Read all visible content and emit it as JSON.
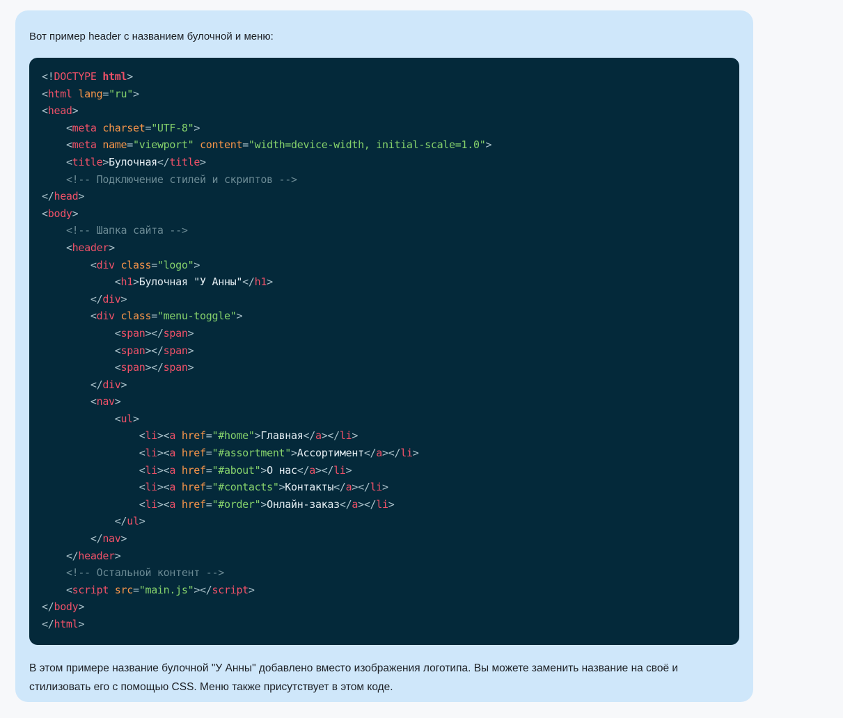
{
  "message": {
    "intro": "Вот пример header с названием булочной и меню:",
    "outro": "В этом примере название булочной \"У Анны\" добавлено вместо изображения логотипа. Вы можете заменить название на своё и стилизовать его с помощью CSS. Меню также присутствует в этом коде."
  },
  "colors": {
    "page_bg": "#f7f8fa",
    "bubble_bg": "#cfe7fa",
    "code_bg": "#04293a",
    "punct": "#a9c0c9",
    "tag": "#ef5168",
    "attr": "#f8964a",
    "string": "#85d16b",
    "comment": "#6b8a94",
    "plain": "#e3edf2",
    "body_text": "#1d2025"
  },
  "code": {
    "language": "html",
    "lines": [
      [
        [
          "p",
          "<!"
        ],
        [
          "t",
          "DOCTYPE "
        ],
        [
          "b",
          "html"
        ],
        [
          "p",
          ">"
        ]
      ],
      [
        [
          "p",
          "<"
        ],
        [
          "t",
          "html"
        ],
        [
          "w",
          " "
        ],
        [
          "a",
          "lang"
        ],
        [
          "p",
          "="
        ],
        [
          "s",
          "\"ru\""
        ],
        [
          "p",
          ">"
        ]
      ],
      [
        [
          "p",
          "<"
        ],
        [
          "t",
          "head"
        ],
        [
          "p",
          ">"
        ]
      ],
      [
        [
          "w",
          "    "
        ],
        [
          "p",
          "<"
        ],
        [
          "t",
          "meta"
        ],
        [
          "w",
          " "
        ],
        [
          "a",
          "charset"
        ],
        [
          "p",
          "="
        ],
        [
          "s",
          "\"UTF-8\""
        ],
        [
          "p",
          ">"
        ]
      ],
      [
        [
          "w",
          "    "
        ],
        [
          "p",
          "<"
        ],
        [
          "t",
          "meta"
        ],
        [
          "w",
          " "
        ],
        [
          "a",
          "name"
        ],
        [
          "p",
          "="
        ],
        [
          "s",
          "\"viewport\""
        ],
        [
          "w",
          " "
        ],
        [
          "a",
          "content"
        ],
        [
          "p",
          "="
        ],
        [
          "s",
          "\"width=device-width, initial-scale=1.0\""
        ],
        [
          "p",
          ">"
        ]
      ],
      [
        [
          "w",
          "    "
        ],
        [
          "p",
          "<"
        ],
        [
          "t",
          "title"
        ],
        [
          "p",
          ">"
        ],
        [
          "w",
          "Булочная"
        ],
        [
          "p",
          "</"
        ],
        [
          "t",
          "title"
        ],
        [
          "p",
          ">"
        ]
      ],
      [
        [
          "w",
          "    "
        ],
        [
          "c",
          "<!-- Подключение стилей и скриптов -->"
        ]
      ],
      [
        [
          "p",
          "</"
        ],
        [
          "t",
          "head"
        ],
        [
          "p",
          ">"
        ]
      ],
      [
        [
          "p",
          "<"
        ],
        [
          "t",
          "body"
        ],
        [
          "p",
          ">"
        ]
      ],
      [
        [
          "w",
          "    "
        ],
        [
          "c",
          "<!-- Шапка сайта -->"
        ]
      ],
      [
        [
          "w",
          "    "
        ],
        [
          "p",
          "<"
        ],
        [
          "t",
          "header"
        ],
        [
          "p",
          ">"
        ]
      ],
      [
        [
          "w",
          "        "
        ],
        [
          "p",
          "<"
        ],
        [
          "t",
          "div"
        ],
        [
          "w",
          " "
        ],
        [
          "a",
          "class"
        ],
        [
          "p",
          "="
        ],
        [
          "s",
          "\"logo\""
        ],
        [
          "p",
          ">"
        ]
      ],
      [
        [
          "w",
          "            "
        ],
        [
          "p",
          "<"
        ],
        [
          "t",
          "h1"
        ],
        [
          "p",
          ">"
        ],
        [
          "w",
          "Булочная \"У Анны\""
        ],
        [
          "p",
          "</"
        ],
        [
          "t",
          "h1"
        ],
        [
          "p",
          ">"
        ]
      ],
      [
        [
          "w",
          "        "
        ],
        [
          "p",
          "</"
        ],
        [
          "t",
          "div"
        ],
        [
          "p",
          ">"
        ]
      ],
      [
        [
          "w",
          "        "
        ],
        [
          "p",
          "<"
        ],
        [
          "t",
          "div"
        ],
        [
          "w",
          " "
        ],
        [
          "a",
          "class"
        ],
        [
          "p",
          "="
        ],
        [
          "s",
          "\"menu-toggle\""
        ],
        [
          "p",
          ">"
        ]
      ],
      [
        [
          "w",
          "            "
        ],
        [
          "p",
          "<"
        ],
        [
          "t",
          "span"
        ],
        [
          "p",
          "></"
        ],
        [
          "t",
          "span"
        ],
        [
          "p",
          ">"
        ]
      ],
      [
        [
          "w",
          "            "
        ],
        [
          "p",
          "<"
        ],
        [
          "t",
          "span"
        ],
        [
          "p",
          "></"
        ],
        [
          "t",
          "span"
        ],
        [
          "p",
          ">"
        ]
      ],
      [
        [
          "w",
          "            "
        ],
        [
          "p",
          "<"
        ],
        [
          "t",
          "span"
        ],
        [
          "p",
          "></"
        ],
        [
          "t",
          "span"
        ],
        [
          "p",
          ">"
        ]
      ],
      [
        [
          "w",
          "        "
        ],
        [
          "p",
          "</"
        ],
        [
          "t",
          "div"
        ],
        [
          "p",
          ">"
        ]
      ],
      [
        [
          "w",
          "        "
        ],
        [
          "p",
          "<"
        ],
        [
          "t",
          "nav"
        ],
        [
          "p",
          ">"
        ]
      ],
      [
        [
          "w",
          "            "
        ],
        [
          "p",
          "<"
        ],
        [
          "t",
          "ul"
        ],
        [
          "p",
          ">"
        ]
      ],
      [
        [
          "w",
          "                "
        ],
        [
          "p",
          "<"
        ],
        [
          "t",
          "li"
        ],
        [
          "p",
          "><"
        ],
        [
          "t",
          "a"
        ],
        [
          "w",
          " "
        ],
        [
          "a",
          "href"
        ],
        [
          "p",
          "="
        ],
        [
          "s",
          "\"#home\""
        ],
        [
          "p",
          ">"
        ],
        [
          "w",
          "Главная"
        ],
        [
          "p",
          "</"
        ],
        [
          "t",
          "a"
        ],
        [
          "p",
          "></"
        ],
        [
          "t",
          "li"
        ],
        [
          "p",
          ">"
        ]
      ],
      [
        [
          "w",
          "                "
        ],
        [
          "p",
          "<"
        ],
        [
          "t",
          "li"
        ],
        [
          "p",
          "><"
        ],
        [
          "t",
          "a"
        ],
        [
          "w",
          " "
        ],
        [
          "a",
          "href"
        ],
        [
          "p",
          "="
        ],
        [
          "s",
          "\"#assortment\""
        ],
        [
          "p",
          ">"
        ],
        [
          "w",
          "Ассортимент"
        ],
        [
          "p",
          "</"
        ],
        [
          "t",
          "a"
        ],
        [
          "p",
          "></"
        ],
        [
          "t",
          "li"
        ],
        [
          "p",
          ">"
        ]
      ],
      [
        [
          "w",
          "                "
        ],
        [
          "p",
          "<"
        ],
        [
          "t",
          "li"
        ],
        [
          "p",
          "><"
        ],
        [
          "t",
          "a"
        ],
        [
          "w",
          " "
        ],
        [
          "a",
          "href"
        ],
        [
          "p",
          "="
        ],
        [
          "s",
          "\"#about\""
        ],
        [
          "p",
          ">"
        ],
        [
          "w",
          "О нас"
        ],
        [
          "p",
          "</"
        ],
        [
          "t",
          "a"
        ],
        [
          "p",
          "></"
        ],
        [
          "t",
          "li"
        ],
        [
          "p",
          ">"
        ]
      ],
      [
        [
          "w",
          "                "
        ],
        [
          "p",
          "<"
        ],
        [
          "t",
          "li"
        ],
        [
          "p",
          "><"
        ],
        [
          "t",
          "a"
        ],
        [
          "w",
          " "
        ],
        [
          "a",
          "href"
        ],
        [
          "p",
          "="
        ],
        [
          "s",
          "\"#contacts\""
        ],
        [
          "p",
          ">"
        ],
        [
          "w",
          "Контакты"
        ],
        [
          "p",
          "</"
        ],
        [
          "t",
          "a"
        ],
        [
          "p",
          "></"
        ],
        [
          "t",
          "li"
        ],
        [
          "p",
          ">"
        ]
      ],
      [
        [
          "w",
          "                "
        ],
        [
          "p",
          "<"
        ],
        [
          "t",
          "li"
        ],
        [
          "p",
          "><"
        ],
        [
          "t",
          "a"
        ],
        [
          "w",
          " "
        ],
        [
          "a",
          "href"
        ],
        [
          "p",
          "="
        ],
        [
          "s",
          "\"#order\""
        ],
        [
          "p",
          ">"
        ],
        [
          "w",
          "Онлайн-заказ"
        ],
        [
          "p",
          "</"
        ],
        [
          "t",
          "a"
        ],
        [
          "p",
          "></"
        ],
        [
          "t",
          "li"
        ],
        [
          "p",
          ">"
        ]
      ],
      [
        [
          "w",
          "            "
        ],
        [
          "p",
          "</"
        ],
        [
          "t",
          "ul"
        ],
        [
          "p",
          ">"
        ]
      ],
      [
        [
          "w",
          "        "
        ],
        [
          "p",
          "</"
        ],
        [
          "t",
          "nav"
        ],
        [
          "p",
          ">"
        ]
      ],
      [
        [
          "w",
          "    "
        ],
        [
          "p",
          "</"
        ],
        [
          "t",
          "header"
        ],
        [
          "p",
          ">"
        ]
      ],
      [
        [
          "w",
          "    "
        ],
        [
          "c",
          "<!-- Остальной контент -->"
        ]
      ],
      [
        [
          "w",
          "    "
        ],
        [
          "p",
          "<"
        ],
        [
          "t",
          "script"
        ],
        [
          "w",
          " "
        ],
        [
          "a",
          "src"
        ],
        [
          "p",
          "="
        ],
        [
          "s",
          "\"main.js\""
        ],
        [
          "p",
          "></"
        ],
        [
          "t",
          "script"
        ],
        [
          "p",
          ">"
        ]
      ],
      [
        [
          "p",
          "</"
        ],
        [
          "t",
          "body"
        ],
        [
          "p",
          ">"
        ]
      ],
      [
        [
          "p",
          "</"
        ],
        [
          "t",
          "html"
        ],
        [
          "p",
          ">"
        ]
      ]
    ]
  }
}
